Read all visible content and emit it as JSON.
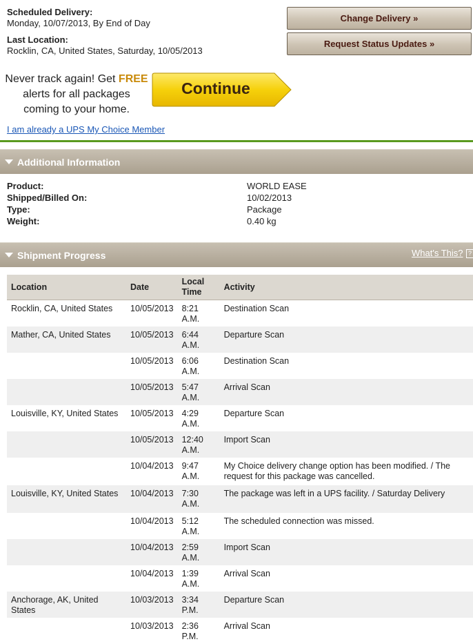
{
  "delivery": {
    "scheduled_label": "Scheduled Delivery:",
    "scheduled_value": "Monday, 10/07/2013, By End of Day",
    "last_location_label": "Last Location:",
    "last_location_value": "Rocklin, CA, United States, Saturday, 10/05/2013"
  },
  "buttons": {
    "change_delivery": "Change Delivery »",
    "request_status": "Request Status Updates »"
  },
  "promo": {
    "line1_prefix": "Never track again! Get ",
    "line1_free": "FREE",
    "line2": "alerts for all packages",
    "line3": "coming to your home.",
    "continue_label": "Continue",
    "member_link": "I am already a UPS My Choice Member"
  },
  "additional": {
    "title": "Additional Information",
    "rows": [
      {
        "label": "Product:",
        "value": "WORLD EASE"
      },
      {
        "label": "Shipped/Billed On:",
        "value": "10/02/2013"
      },
      {
        "label": "Type:",
        "value": "Package"
      },
      {
        "label": "Weight:",
        "value": "0.40 kg"
      }
    ]
  },
  "progress": {
    "title": "Shipment Progress",
    "whats_this": "What's This?",
    "help_icon": "?",
    "columns": [
      "Location",
      "Date",
      "Local Time",
      "Activity"
    ],
    "rows": [
      {
        "location": "Rocklin, CA, United States",
        "date": "10/05/2013",
        "time": "8:21 A.M.",
        "activity": "Destination Scan"
      },
      {
        "location": "Mather, CA, United States",
        "date": "10/05/2013",
        "time": "6:44 A.M.",
        "activity": "Departure Scan"
      },
      {
        "location": "",
        "date": "10/05/2013",
        "time": "6:06 A.M.",
        "activity": "Destination Scan"
      },
      {
        "location": "",
        "date": "10/05/2013",
        "time": "5:47 A.M.",
        "activity": "Arrival Scan"
      },
      {
        "location": "Louisville, KY, United States",
        "date": "10/05/2013",
        "time": "4:29 A.M.",
        "activity": "Departure Scan"
      },
      {
        "location": "",
        "date": "10/05/2013",
        "time": "12:40 A.M.",
        "activity": "Import Scan"
      },
      {
        "location": "",
        "date": "10/04/2013",
        "time": "9:47 A.M.",
        "activity": "My Choice delivery change option has been modified. / The request for this package was cancelled."
      },
      {
        "location": "Louisville, KY, United States",
        "date": "10/04/2013",
        "time": "7:30 A.M.",
        "activity": "The package was left in a UPS facility. / Saturday Delivery"
      },
      {
        "location": "",
        "date": "10/04/2013",
        "time": "5:12 A.M.",
        "activity": "The scheduled connection was missed."
      },
      {
        "location": "",
        "date": "10/04/2013",
        "time": "2:59 A.M.",
        "activity": "Import Scan"
      },
      {
        "location": "",
        "date": "10/04/2013",
        "time": "1:39 A.M.",
        "activity": "Arrival Scan"
      },
      {
        "location": "Anchorage, AK, United States",
        "date": "10/03/2013",
        "time": "3:34 P.M.",
        "activity": "Departure Scan"
      },
      {
        "location": "",
        "date": "10/03/2013",
        "time": "2:36 P.M.",
        "activity": "Arrival Scan"
      }
    ]
  },
  "colors": {
    "accent_free": "#c98a0a",
    "continue_yellow": "#f6d10b",
    "green_rule": "#5a9a1f",
    "section_header": "#aaa08f"
  }
}
